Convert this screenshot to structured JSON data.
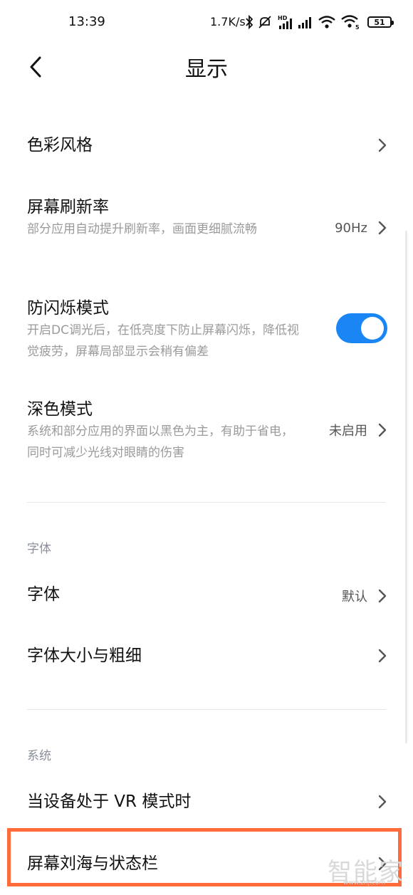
{
  "status_bar": {
    "time": "13:39",
    "net_speed": "1.7K/s",
    "battery": "51",
    "icons": [
      "bluetooth-icon",
      "mute-icon",
      "hd-signal-icon",
      "signal-icon",
      "wifi-icon",
      "wifi-calling-icon",
      "battery-icon"
    ]
  },
  "header": {
    "title": "显示",
    "back_icon": "back-arrow-icon"
  },
  "items": {
    "color_style": {
      "title": "色彩风格"
    },
    "refresh_rate": {
      "title": "屏幕刷新率",
      "subtitle": "部分应用自动提升刷新率，画面更细腻流畅",
      "value": "90Hz"
    },
    "anti_flicker": {
      "title": "防闪烁模式",
      "subtitle": "开启DC调光后，在低亮度下防止屏幕闪烁，降低视觉疲劳，屏幕局部显示会稍有偏差",
      "toggle_on": true
    },
    "dark_mode": {
      "title": "深色模式",
      "subtitle": "系统和部分应用的界面以黑色为主，有助于省电，同时可减少光线对眼睛的伤害",
      "value": "未启用"
    },
    "font": {
      "title": "字体",
      "value": "默认"
    },
    "font_size": {
      "title": "字体大小与粗细"
    },
    "vr_mode": {
      "title": "当设备处于 VR 模式时"
    },
    "notch": {
      "title": "屏幕刘海与状态栏"
    }
  },
  "sections": {
    "font": "字体",
    "system": "系统"
  },
  "watermark": {
    "text": "智能家",
    "url": "www.znj.com"
  },
  "colors": {
    "accent": "#1a86f5",
    "highlight": "#ff6b3a",
    "subtitle": "#9a9a9a",
    "section": "#8a8f99"
  }
}
